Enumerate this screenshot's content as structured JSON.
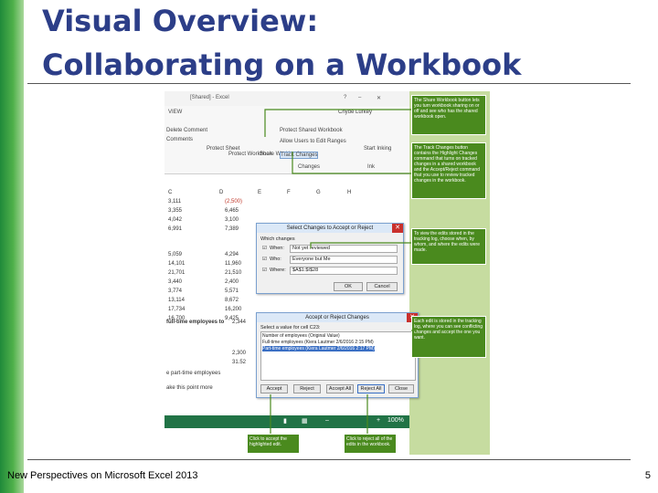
{
  "slide": {
    "title_line1": "Visual Overview:",
    "title_line2": "Collaborating on a Workbook",
    "footer": "New Perspectives on Microsoft Excel 2013",
    "page_number": "5"
  },
  "excel": {
    "window_title": "[Shared] - Excel",
    "user": "Chyde Lurkey",
    "tab_review": "VIEW",
    "ribbon": {
      "delete_comment": "Delete Comment",
      "comments": "Comments",
      "protect_sheet": "Protect Sheet",
      "protect_workbook": "Protect Workbook",
      "share_workbook": "Share Workbook",
      "protect_shared": "Protect Shared Workbook",
      "allow_users": "Allow Users to Edit Ranges",
      "track_changes": "Track Changes",
      "changes_group": "Changes",
      "start_inking": "Start Inking",
      "ink_group": "Ink"
    },
    "col_headers": [
      "C",
      "D",
      "E",
      "F",
      "G",
      "H"
    ],
    "col_c": [
      "3,111",
      "3,355",
      "4,042",
      "6,991",
      "",
      "",
      "5,059",
      "14,101",
      "21,701",
      "3,440",
      "3,774",
      "13,114",
      "17,734",
      "16,700"
    ],
    "col_d": [
      "(2,500)",
      "6,465",
      "3,100",
      "7,389",
      "",
      "",
      "4,294",
      "11,960",
      "21,510",
      "2,400",
      "5,571",
      "8,672",
      "16,200",
      "9,425"
    ],
    "label_full_time": "full-time employees to",
    "value_full_time": "2,344",
    "val_a": "2,300",
    "val_b": "31.52",
    "label_part_time": "e part-time employees",
    "label_point": "ake this point more",
    "zoom": "100%"
  },
  "dialog_select": {
    "title": "Select Changes to Accept or Reject",
    "which_changes": "Which changes",
    "when_label": "When:",
    "when_value": "Not yet reviewed",
    "who_label": "Who:",
    "who_value": "Everyone but Me",
    "where_label": "Where:",
    "where_value": "$A$1:$I$28",
    "ok": "OK",
    "cancel": "Cancel"
  },
  "dialog_accept": {
    "title": "Accept or Reject Changes",
    "change_header": "Select a value for cell C23:",
    "rows": [
      "Number of employees (Original Value)",
      "Full-time employees (Kiera Lautmer 2/6/2016 2:15 PM)",
      "Part-time employees (Kiera Lautmer 2/6/2016 2:17 PM)"
    ],
    "accept": "Accept",
    "reject": "Reject",
    "accept_all": "Accept All",
    "reject_all": "Reject All",
    "close": "Close"
  },
  "callouts": {
    "share": "The Share Workbook button lets you turn workbook sharing on or off and see who has the shared workbook open.",
    "track": "The Track Changes button contains the Highlight Changes command that turns on tracked changes in a shared workbook and the Accept/Reject command that you use to review tracked changes in the workbook.",
    "filter": "To view the edits stored in the tracking log, choose when, by whom, and where the edits were made.",
    "log": "Each edit is stored in the tracking log, where you can see conflicting changes and accept the one you want.",
    "accept_btn": "Click to accept the highlighted edit.",
    "reject_all_btn": "Click to reject all of the edits in the workbook."
  },
  "colors": {
    "title": "#2c3e88",
    "callout": "#4a8a1e",
    "excel_green": "#217346"
  }
}
